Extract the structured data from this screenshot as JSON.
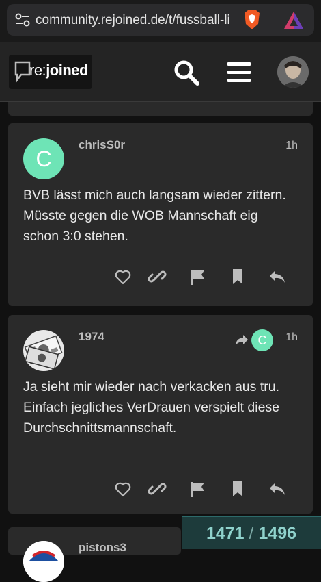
{
  "browser": {
    "url": "community.rejoined.de/t/fussball-li"
  },
  "header": {
    "logo_prefix": "re:",
    "logo_suffix": "joined"
  },
  "posts": [
    {
      "username": "chrisS0r",
      "avatar_letter": "C",
      "time": "1h",
      "body": "BVB lässt mich auch langsam wieder zittern. Müsste gegen die WOB Mannschaft eig schon 3:0 stehen."
    },
    {
      "username": "1974",
      "time": "1h",
      "reply_to_avatar_letter": "C",
      "body": "Ja sieht mir wieder nach verkacken aus tru. Einfach jegliches VerDrauen verspielt diese Durchschnittsmannschaft."
    }
  ],
  "next_post": {
    "username": "pistons3"
  },
  "progress": {
    "current": "1471",
    "separator": "/",
    "total": "1496"
  },
  "colors": {
    "letter_avatar": "#6ee4b6",
    "progress_bg": "#1d3b3b",
    "progress_text": "#8fd2cc"
  }
}
